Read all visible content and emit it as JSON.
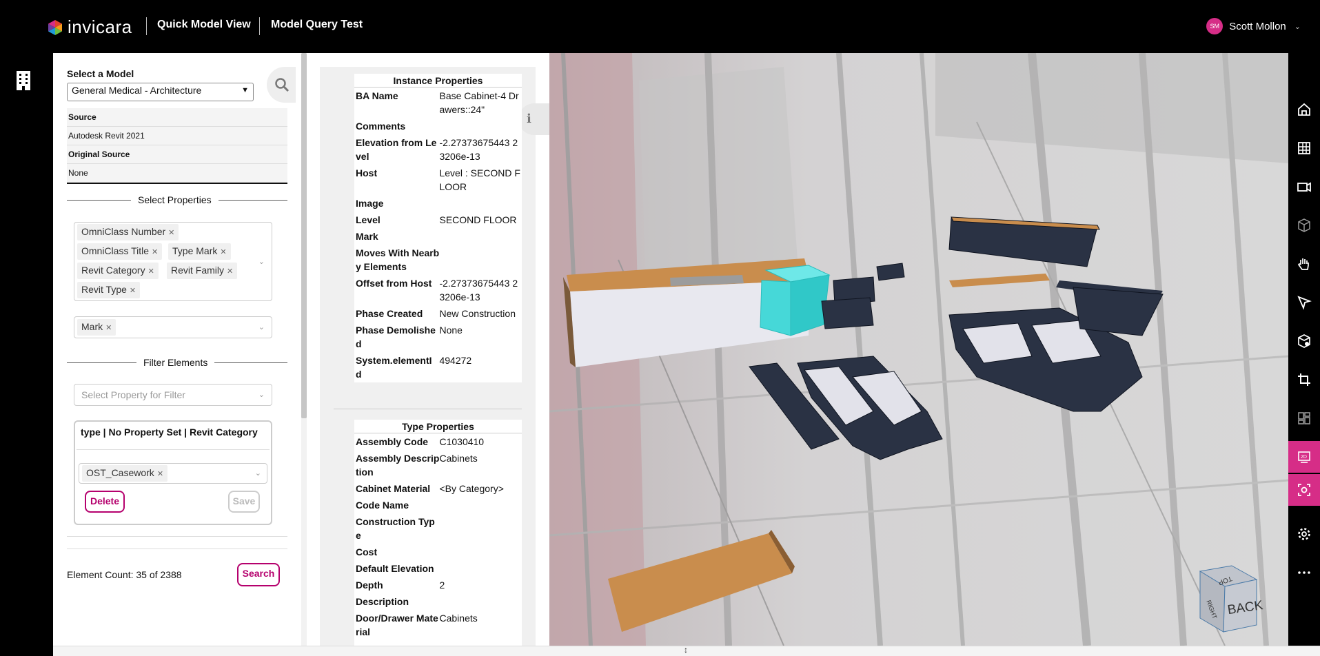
{
  "header": {
    "brand": "invicara",
    "app_name": "Quick Model View",
    "page_name": "Model Query Test",
    "user_initials": "SM",
    "user_name": "Scott Mollon"
  },
  "left_panel": {
    "model_label": "Select a Model",
    "model_selected": "General Medical - Architecture",
    "source_label": "Source",
    "source_value": "Autodesk Revit 2021",
    "original_source_label": "Original Source",
    "original_source_value": "None",
    "select_properties_title": "Select Properties",
    "property_chips": [
      "OmniClass Number",
      "OmniClass Title",
      "Type Mark",
      "Revit Category",
      "Revit Family",
      "Revit Type"
    ],
    "mark_chip": "Mark",
    "filter_title": "Filter Elements",
    "filter_placeholder": "Select Property for Filter",
    "filter_header": "type | No Property Set | Revit Category",
    "filter_chip": "OST_Casework",
    "delete_label": "Delete",
    "save_label": "Save",
    "element_count": "Element Count: 35 of 2388",
    "search_label": "Search"
  },
  "instance_properties": {
    "title": "Instance Properties",
    "rows": [
      {
        "k": "BA Name",
        "v": "Base Cabinet-4 Drawers::24\""
      },
      {
        "k": "Comments",
        "v": ""
      },
      {
        "k": "Elevation from Level",
        "v": "-2.27373675443 23206e-13"
      },
      {
        "k": "Host",
        "v": "Level : SECOND FLOOR"
      },
      {
        "k": "Image",
        "v": ""
      },
      {
        "k": "Level",
        "v": "SECOND FLOOR"
      },
      {
        "k": "Mark",
        "v": ""
      },
      {
        "k": "Moves With Nearby Elements",
        "v": ""
      },
      {
        "k": "Offset from Host",
        "v": "-2.27373675443 23206e-13"
      },
      {
        "k": "Phase Created",
        "v": "New Construction"
      },
      {
        "k": "Phase Demolished",
        "v": "None"
      },
      {
        "k": "System.elementI d",
        "v": "494272"
      }
    ]
  },
  "type_properties": {
    "title": "Type Properties",
    "rows": [
      {
        "k": "Assembly Code",
        "v": "C1030410"
      },
      {
        "k": "Assembly Description",
        "v": "Cabinets"
      },
      {
        "k": "Cabinet Material",
        "v": "<By Category>"
      },
      {
        "k": "Code Name",
        "v": ""
      },
      {
        "k": "Construction Type",
        "v": ""
      },
      {
        "k": "Cost",
        "v": ""
      },
      {
        "k": "Default Elevation",
        "v": ""
      },
      {
        "k": "Depth",
        "v": "2"
      },
      {
        "k": "Description",
        "v": ""
      },
      {
        "k": "Door/Drawer Material",
        "v": "Cabinets"
      }
    ]
  },
  "viewer": {
    "viewcube_top": "TOP",
    "viewcube_side": "RIGHT",
    "viewcube_front": "BACK"
  },
  "right_toolbar": {
    "icons": [
      "home-icon",
      "grid-icon",
      "camera-icon",
      "cube-icon",
      "hand-icon",
      "select-icon",
      "section-box-icon",
      "crop-icon",
      "layout-icon",
      "2d-icon",
      "focus-icon",
      "gear-icon",
      "more-icon"
    ]
  },
  "colors": {
    "accent": "#b5006d",
    "pink_toolbar": "#d62d87",
    "highlight": "#3fe0e0"
  }
}
